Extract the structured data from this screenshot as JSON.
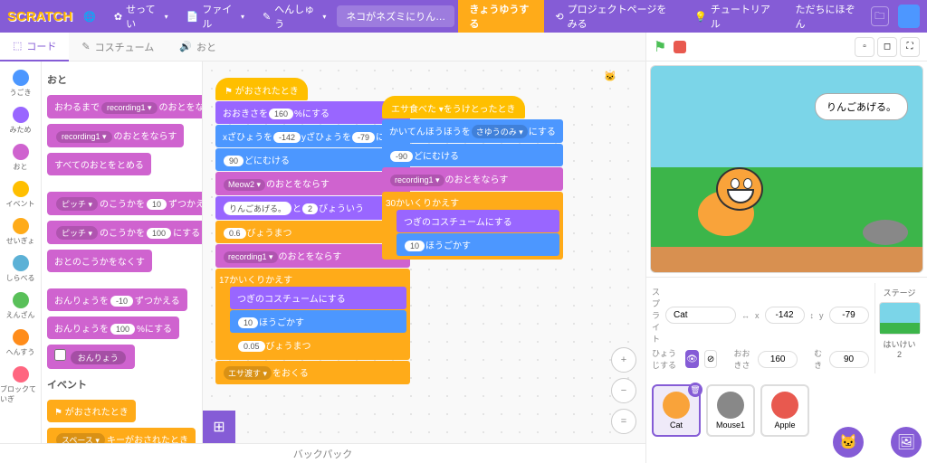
{
  "topbar": {
    "logo": "SCRATCH",
    "settings": "せってい",
    "file": "ファイル",
    "edit": "へんしゅう",
    "projectTitle": "ネコがネズミにりんごをあ…",
    "share": "きょうゆうする",
    "projectPage": "プロジェクトページをみる",
    "tutorials": "チュートリアル",
    "saveStatus": "ただちにほぞん"
  },
  "tabs": {
    "code": "コード",
    "costumes": "コスチューム",
    "sounds": "おと"
  },
  "categories": [
    {
      "name": "うごき",
      "color": "#4c97ff"
    },
    {
      "name": "みため",
      "color": "#9966ff"
    },
    {
      "name": "おと",
      "color": "#cf63cf"
    },
    {
      "name": "イベント",
      "color": "#ffbf00"
    },
    {
      "name": "せいぎょ",
      "color": "#ffab19"
    },
    {
      "name": "しらべる",
      "color": "#5cb1d6"
    },
    {
      "name": "えんざん",
      "color": "#59c059"
    },
    {
      "name": "へんすう",
      "color": "#ff8c1a"
    },
    {
      "name": "ブロックていぎ",
      "color": "#ff6680"
    }
  ],
  "palette": {
    "soundHeader": "おと",
    "eventsHeader": "イベント",
    "blocks": {
      "playUntilDone": {
        "pre": "おわるまで",
        "dd": "recording1 ▾",
        "post": "のおとをならす"
      },
      "play": {
        "dd": "recording1 ▾",
        "post": "のおとをならす"
      },
      "stopAll": "すべてのおとをとめる",
      "changeEffect": {
        "pre": "ピッチ ▾",
        "mid": "のこうかを",
        "val": "10",
        "post": "ずつかえ"
      },
      "setEffect": {
        "pre": "ピッチ ▾",
        "mid": "のこうかを",
        "val": "100",
        "post": "にする"
      },
      "clearEffects": "おとのこうかをなくす",
      "changeVolume": {
        "pre": "おんりょうを",
        "val": "-10",
        "post": "ずつかえる"
      },
      "setVolume": {
        "pre": "おんりょうを",
        "val": "100",
        "post": "%にする"
      },
      "volume": "おんりょう",
      "whenFlag": "⚑ がおされたとき",
      "whenKey": {
        "dd": "スペース ▾",
        "post": "キーがおされたとき"
      }
    }
  },
  "script1": {
    "hat": "⚑ がおされたとき",
    "setSize": {
      "pre": "おおきさを",
      "val": "160",
      "post": "%にする"
    },
    "goto": {
      "pre": "xざひょうを",
      "x": "-142",
      "mid": "yざひょうを",
      "y": "-79",
      "post": "にする"
    },
    "point": {
      "val": "90",
      "post": "どにむける"
    },
    "playSound": {
      "dd": "Meow2 ▾",
      "post": "のおとをならす"
    },
    "say": {
      "txt": "りんごあげる。",
      "mid": "と",
      "sec": "2",
      "post": "びょういう"
    },
    "wait1": {
      "val": "0.6",
      "post": "びょうまつ"
    },
    "playRec": {
      "dd": "recording1 ▾",
      "post": "のおとをならす"
    },
    "repeat": {
      "val": "17",
      "post": "かいくりかえす"
    },
    "nextCostume": "つぎのコスチュームにする",
    "move": {
      "val": "10",
      "post": "ほうごかす"
    },
    "wait2": {
      "val": "0.05",
      "post": "びょうまつ"
    },
    "broadcast": {
      "dd": "エサ渡す ▾",
      "post": "をおくる"
    }
  },
  "script2": {
    "hat": {
      "dd": "エサ食べた ▾",
      "post": "をうけとったとき"
    },
    "rotStyle": {
      "pre": "かいてんほうほうを",
      "dd": "さゆうのみ ▾",
      "post": "にする"
    },
    "point": {
      "val": "-90",
      "post": "どにむける"
    },
    "playRec": {
      "dd": "recording1 ▾",
      "post": "のおとをならす"
    },
    "repeat": {
      "val": "30",
      "post": "かいくりかえす"
    },
    "nextCostume": "つぎのコスチュームにする",
    "move": {
      "val": "10",
      "post": "ほうごかす"
    }
  },
  "stage": {
    "speechBubble": "りんごあげる。"
  },
  "spriteInfo": {
    "label": "スプライト",
    "name": "Cat",
    "xLabel": "x",
    "x": "-142",
    "yLabel": "y",
    "y": "-79",
    "showLabel": "ひょうじする",
    "sizeLabel": "おおきさ",
    "size": "160",
    "dirLabel": "むき",
    "dir": "90"
  },
  "stagePanel": {
    "label": "ステージ",
    "backdropLabel": "はいけい",
    "count": "2"
  },
  "sprites": [
    {
      "name": "Cat",
      "color": "#f9a33a"
    },
    {
      "name": "Mouse1",
      "color": "#888"
    },
    {
      "name": "Apple",
      "color": "#e8594f"
    }
  ],
  "backpack": "バックパック"
}
